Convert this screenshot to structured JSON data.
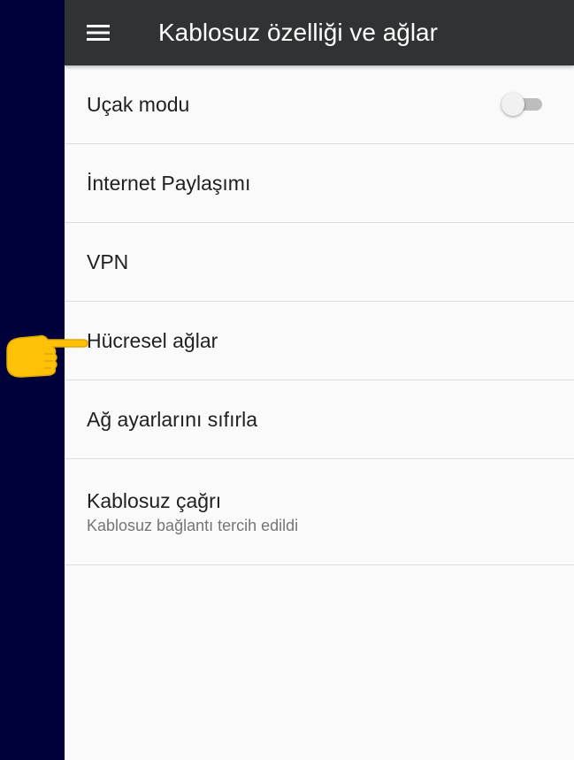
{
  "header": {
    "title": "Kablosuz özelliği ve ağlar",
    "menu_icon": "hamburger-menu-icon"
  },
  "settings": {
    "airplane_mode": {
      "label": "Uçak modu",
      "toggle_on": false
    },
    "tethering": {
      "label": "İnternet Paylaşımı"
    },
    "vpn": {
      "label": "VPN"
    },
    "cellular": {
      "label": "Hücresel ağlar"
    },
    "reset_network": {
      "label": "Ağ ayarlarını sıfırla"
    },
    "wifi_calling": {
      "label": "Kablosuz çağrı",
      "subtitle": "Kablosuz bağlantı tercih edildi"
    }
  },
  "annotation": {
    "icon": "pointing-hand-icon",
    "color": "#ffc107"
  },
  "colors": {
    "app_bar": "#2f3334",
    "background": "#fafafa",
    "side_band": "#00003a"
  }
}
